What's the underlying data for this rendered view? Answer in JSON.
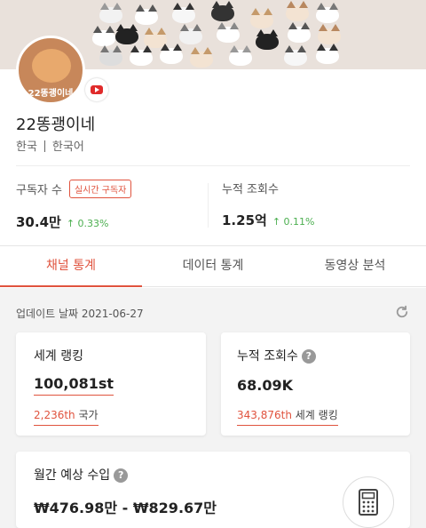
{
  "channel": {
    "name": "22똥괭이네",
    "avatar_label": "22똥괭이네",
    "country": "한국",
    "language": "한국어",
    "platform_icon": "youtube-icon"
  },
  "stats": {
    "subscribers_label": "구독자 수",
    "realtime_label": "실시간 구독자",
    "subscribers_value": "30.4만",
    "subscribers_change": "0.33%",
    "views_label": "누적 조회수",
    "views_value": "1.25억",
    "views_change": "0.11%"
  },
  "tabs": [
    {
      "label": "채널 통계",
      "active": true
    },
    {
      "label": "데이터 통계",
      "active": false
    },
    {
      "label": "동영상 분석",
      "active": false
    }
  ],
  "update": {
    "label": "업데이트 날짜 2021-06-27"
  },
  "cards": {
    "world_rank": {
      "title": "세계 랭킹",
      "value": "100,081st",
      "sub_value": "2,236th",
      "sub_label": "국가"
    },
    "total_views": {
      "title": "누적 조회수",
      "value": "68.09K",
      "sub_value": "343,876th",
      "sub_label": "세계 랭킹"
    },
    "monthly_income": {
      "title": "월간 예상 수입",
      "value": "₩476.98만 - ₩829.67만"
    }
  },
  "colors": {
    "accent": "#e0533e",
    "positive": "#4caf50",
    "banner": "#e9e1db"
  }
}
